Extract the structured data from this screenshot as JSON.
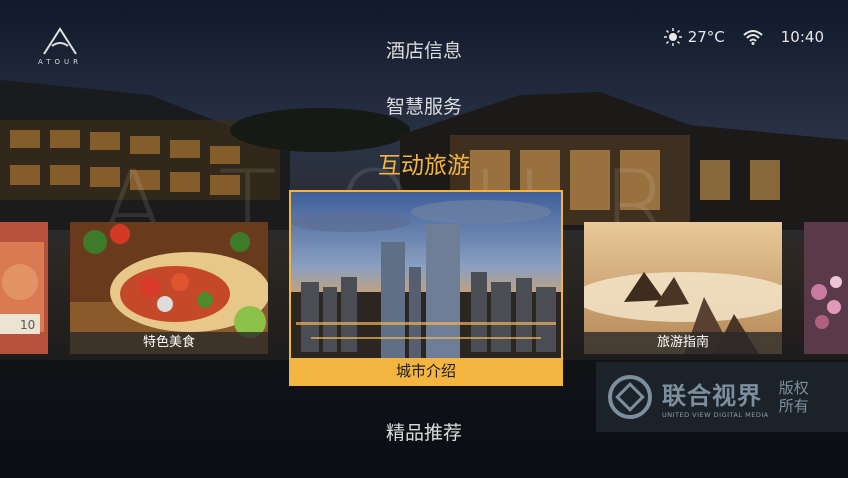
{
  "brand": {
    "logo_letter": "A",
    "logo_text": "ATOUR",
    "ghost_text": "ATOUR"
  },
  "status": {
    "weather_icon": "sun-icon",
    "temperature": "27°C",
    "wifi_icon": "wifi-icon",
    "time": "10:40"
  },
  "menu": {
    "items": [
      "酒店信息",
      "智慧服务",
      "互动旅游",
      "精品推荐"
    ],
    "active_index": 2
  },
  "cards": [
    {
      "label": ""
    },
    {
      "label": "特色美食"
    },
    {
      "label": "城市介绍"
    },
    {
      "label": "旅游指南"
    },
    {
      "label": ""
    }
  ],
  "watermark": {
    "brand": "联合视界",
    "sub": "UNITED VIEW DIGITAL MEDIA",
    "right_line1": "版权",
    "right_line2": "所有"
  },
  "colors": {
    "accent": "#f3b53f",
    "background": "#0e1622"
  }
}
